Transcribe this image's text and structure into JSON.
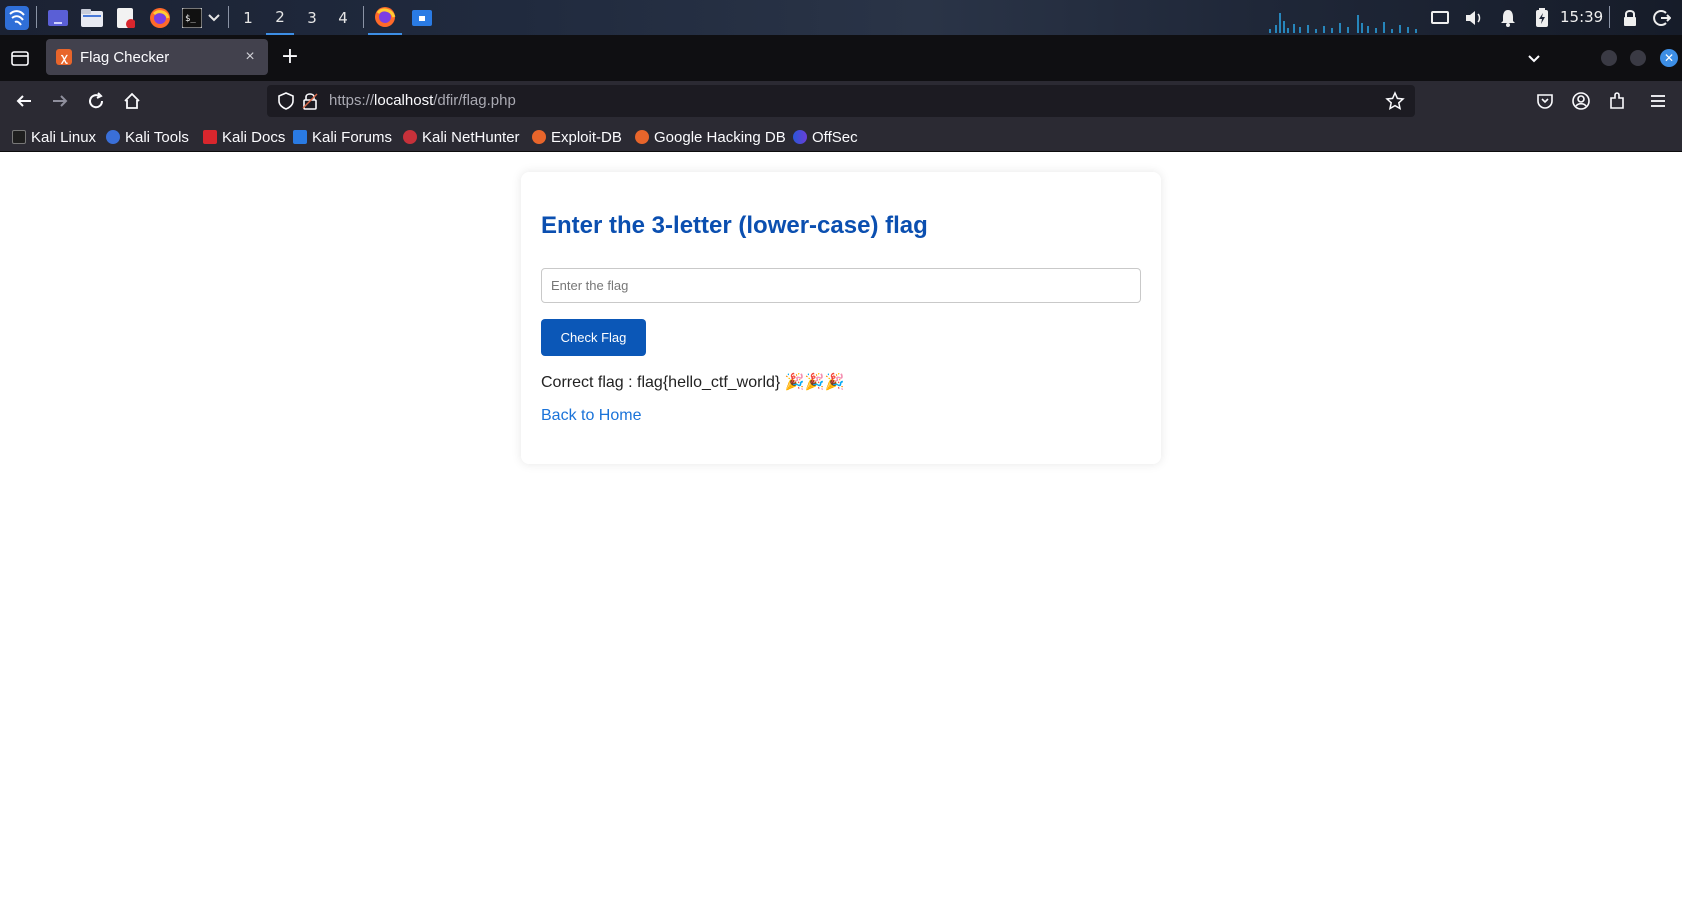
{
  "system_panel": {
    "workspaces": [
      "1",
      "2",
      "3",
      "4"
    ],
    "active_workspace": "2",
    "clock": "15:39",
    "accent_color": "#3d8ee5"
  },
  "browser": {
    "tab": {
      "title": "Flag Checker",
      "close_glyph": "×"
    },
    "new_tab_glyph": "+",
    "url": {
      "scheme": "https://",
      "host": "localhost",
      "path": "/dfir/flag.php"
    },
    "bookmarks": [
      {
        "label": "Kali Linux",
        "icon": "kali-dragon-icon"
      },
      {
        "label": "Kali Tools",
        "icon": "kali-tools-icon"
      },
      {
        "label": "Kali Docs",
        "icon": "kali-docs-icon"
      },
      {
        "label": "Kali Forums",
        "icon": "kali-forums-icon"
      },
      {
        "label": "Kali NetHunter",
        "icon": "nethunter-icon"
      },
      {
        "label": "Exploit-DB",
        "icon": "exploit-db-icon"
      },
      {
        "label": "Google Hacking DB",
        "icon": "ghdb-icon"
      },
      {
        "label": "OffSec",
        "icon": "offsec-icon"
      }
    ]
  },
  "page": {
    "heading": "Enter the 3-letter (lower-case) flag",
    "input_placeholder": "Enter the flag",
    "input_value": "",
    "button_label": "Check Flag",
    "result_text": "Correct flag : flag{hello_ctf_world} 🎉🎉🎉",
    "back_link": "Back to Home",
    "heading_color": "#0b4fb0",
    "button_color": "#0b57b7",
    "link_color": "#1a73d9"
  }
}
